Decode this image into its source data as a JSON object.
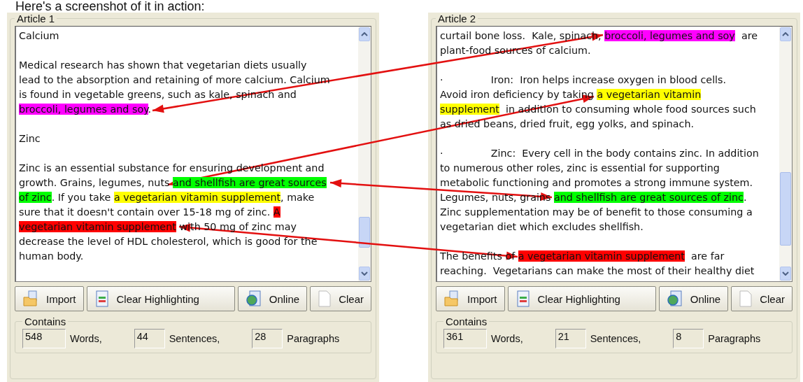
{
  "caption": "Here's a screenshot of it in action:",
  "articles": [
    {
      "title": "Article 1",
      "paragraphs": [
        [
          [
            {
              "text": "Calcium"
            }
          ]
        ],
        [
          [
            {
              "text": "Medical research has shown that vegetarian diets usually"
            }
          ],
          [
            {
              "text": "lead to the absorption and retaining of more calcium. Calcium"
            }
          ],
          [
            {
              "text": "is found in vegetable greens, such as kale, spinach and"
            }
          ],
          [
            {
              "text": "broccoli, legumes and soy",
              "color": "#ff00ff"
            },
            {
              "text": "."
            }
          ]
        ],
        [
          [
            {
              "text": "Zinc"
            }
          ]
        ],
        [
          [
            {
              "text": "Zinc is an essential substance for ensuring development and"
            }
          ],
          [
            {
              "text": "growth. Grains, legumes, nuts "
            },
            {
              "text": "and shellfish are great sources",
              "color": "#00ff00"
            }
          ],
          [
            {
              "text": "of zinc",
              "color": "#00ff00"
            },
            {
              "text": ". If you take "
            },
            {
              "text": "a vegetarian vitamin supplement",
              "color": "#ffff00"
            },
            {
              "text": ", make"
            }
          ],
          [
            {
              "text": "sure that it doesn't contain over 15-18 mg of zinc. "
            },
            {
              "text": "A",
              "color": "#ff0000"
            }
          ],
          [
            {
              "text": "vegetarian vitamin supplement",
              "color": "#ff0000"
            },
            {
              "text": " with 50 mg of zinc may"
            }
          ],
          [
            {
              "text": "decrease the level of HDL cholesterol, which is good for the"
            }
          ],
          [
            {
              "text": "human body."
            }
          ]
        ]
      ],
      "buttons": [
        {
          "label": "Import",
          "kind": "import"
        },
        {
          "label": "Clear Highlighting",
          "kind": "clear-highlighting"
        },
        {
          "label": "Online",
          "kind": "online"
        },
        {
          "label": "Clear",
          "kind": "clear"
        }
      ],
      "contains": {
        "title": "Contains",
        "stats": [
          {
            "value": "548",
            "label": "Words,"
          },
          {
            "value": "44",
            "label": "Sentences,"
          },
          {
            "value": "28",
            "label": "Paragraphs"
          }
        ]
      }
    },
    {
      "title": "Article 2",
      "paragraphs": [
        [
          [
            {
              "text": "curtail bone loss.  Kale, spinach, "
            },
            {
              "text": "broccoli, legumes and soy",
              "color": "#ff00ff"
            },
            {
              "text": "  are"
            }
          ],
          [
            {
              "text": "plant-food sources of calcium."
            }
          ]
        ],
        [
          [
            {
              "text": "·               Iron:  Iron helps increase oxygen in blood cells."
            }
          ],
          [
            {
              "text": "Avoid iron deficiency by taking "
            },
            {
              "text": "a vegetarian vitamin",
              "color": "#ffff00"
            }
          ],
          [
            {
              "text": "supplement",
              "color": "#ffff00"
            },
            {
              "text": "  in addition to consuming whole food sources such"
            }
          ],
          [
            {
              "text": "as dried beans, dried fruit, egg yolks, and spinach."
            }
          ]
        ],
        [
          [
            {
              "text": "·               Zinc:  Every cell in the body contains zinc. In addition"
            }
          ],
          [
            {
              "text": "to numerous other roles, zinc is essential for supporting"
            }
          ],
          [
            {
              "text": "metabolic functioning and promotes a strong immune system."
            }
          ],
          [
            {
              "text": "Legumes, nuts, grains "
            },
            {
              "text": "and shellfish are great sources of zinc",
              "color": "#00ff00"
            },
            {
              "text": "."
            }
          ],
          [
            {
              "text": "Zinc supplementation may be of benefit to those consuming a"
            }
          ],
          [
            {
              "text": "vegetarian diet which excludes shellfish."
            }
          ]
        ],
        [
          [
            {
              "text": "The benefits of "
            },
            {
              "text": "a vegetarian vitamin supplement",
              "color": "#ff0000"
            },
            {
              "text": "  are far"
            }
          ],
          [
            {
              "text": "reaching.  Vegetarians can make the most of their healthy diet"
            }
          ]
        ]
      ],
      "buttons": [
        {
          "label": "Import",
          "kind": "import"
        },
        {
          "label": "Clear Highlighting",
          "kind": "clear-highlighting"
        },
        {
          "label": "Online",
          "kind": "online"
        },
        {
          "label": "Clear",
          "kind": "clear"
        }
      ],
      "contains": {
        "title": "Contains",
        "stats": [
          {
            "value": "361",
            "label": "Words,"
          },
          {
            "value": "21",
            "label": "Sentences,"
          },
          {
            "value": "8",
            "label": "Paragraphs"
          }
        ]
      }
    }
  ]
}
